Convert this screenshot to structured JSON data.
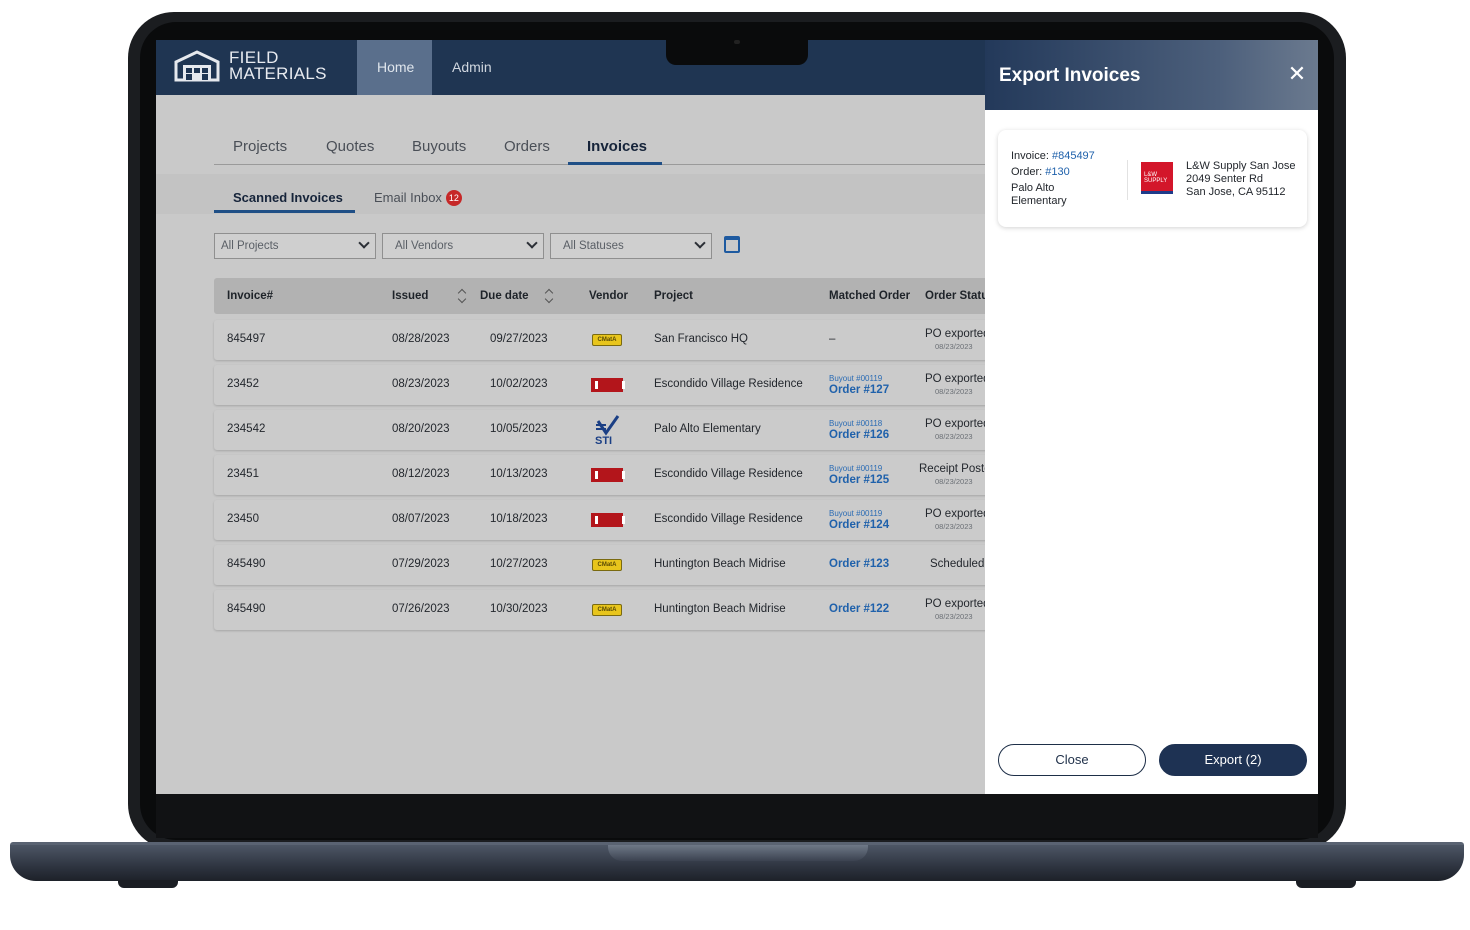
{
  "app": {
    "logo_line1": "FIELD",
    "logo_line2": "MATERIALS",
    "nav": [
      "Home",
      "Admin"
    ]
  },
  "tabs": [
    "Projects",
    "Quotes",
    "Buyouts",
    "Orders",
    "Invoices"
  ],
  "subtabs": {
    "scanned": "Scanned Invoices",
    "email": "Email Inbox",
    "email_badge": "12"
  },
  "filters": {
    "projects": "All Projects",
    "vendors": "All Vendors",
    "statuses": "All Statuses"
  },
  "table": {
    "headers": [
      "Invoice#",
      "Issued",
      "Due date",
      "Vendor",
      "Project",
      "Matched Order",
      "Order Status"
    ],
    "rows": [
      {
        "invoice": "845497",
        "issued": "08/28/2023",
        "due": "09/27/2023",
        "vendor_logo": "yellow",
        "vendor_text": "CMatA",
        "project": "San Francisco HQ",
        "buyout": "",
        "order": "–",
        "status": "PO exported",
        "status_date": "08/23/2023"
      },
      {
        "invoice": "23452",
        "issued": "08/23/2023",
        "due": "10/02/2023",
        "vendor_logo": "red",
        "vendor_text": "",
        "project": "Escondido Village Residence",
        "buyout": "Buyout #00119",
        "order": "Order #127",
        "status": "PO exported",
        "status_date": "08/23/2023"
      },
      {
        "invoice": "234542",
        "issued": "08/20/2023",
        "due": "10/05/2023",
        "vendor_logo": "sti",
        "vendor_text": "STI",
        "project": "Palo Alto Elementary",
        "buyout": "Buyout #00118",
        "order": "Order #126",
        "status": "PO exported",
        "status_date": "08/23/2023"
      },
      {
        "invoice": "23451",
        "issued": "08/12/2023",
        "due": "10/13/2023",
        "vendor_logo": "red",
        "vendor_text": "",
        "project": "Escondido Village Residence",
        "buyout": "Buyout #00119",
        "order": "Order #125",
        "status": "Receipt Posted",
        "status_date": "08/23/2023"
      },
      {
        "invoice": "23450",
        "issued": "08/07/2023",
        "due": "10/18/2023",
        "vendor_logo": "red",
        "vendor_text": "",
        "project": "Escondido Village Residence",
        "buyout": "Buyout #00119",
        "order": "Order #124",
        "status": "PO exported",
        "status_date": "08/23/2023"
      },
      {
        "invoice": "845490",
        "issued": "07/29/2023",
        "due": "10/27/2023",
        "vendor_logo": "yellow",
        "vendor_text": "CMatA",
        "project": "Huntington Beach Midrise",
        "buyout": "",
        "order": "Order #123",
        "status": "Scheduled",
        "status_date": ""
      },
      {
        "invoice": "845490",
        "issued": "07/26/2023",
        "due": "10/30/2023",
        "vendor_logo": "yellow",
        "vendor_text": "CMatA",
        "project": "Huntington Beach Midrise",
        "buyout": "",
        "order": "Order #122",
        "status": "PO exported",
        "status_date": "08/23/2023"
      }
    ]
  },
  "panel": {
    "title": "Export Invoices",
    "close_glyph": "✕",
    "invoice_label": "Invoice: ",
    "invoice_value": "#845497",
    "order_label": "Order: ",
    "order_value": "#130",
    "project_line1": "Palo Alto",
    "project_line2": "Elementary",
    "vendor_logo_text_1": "L&W",
    "vendor_logo_text_2": "SUPPLY",
    "vendor_name": "L&W Supply San Jose",
    "vendor_address1": "2049 Senter Rd",
    "vendor_address2": "San Jose, CA 95112",
    "close_button": "Close",
    "export_button": "Export (2)"
  },
  "colors": {
    "header": "#1f3552",
    "accent": "#1f61ab",
    "badge": "#c62828",
    "primary_button": "#1e3253"
  }
}
